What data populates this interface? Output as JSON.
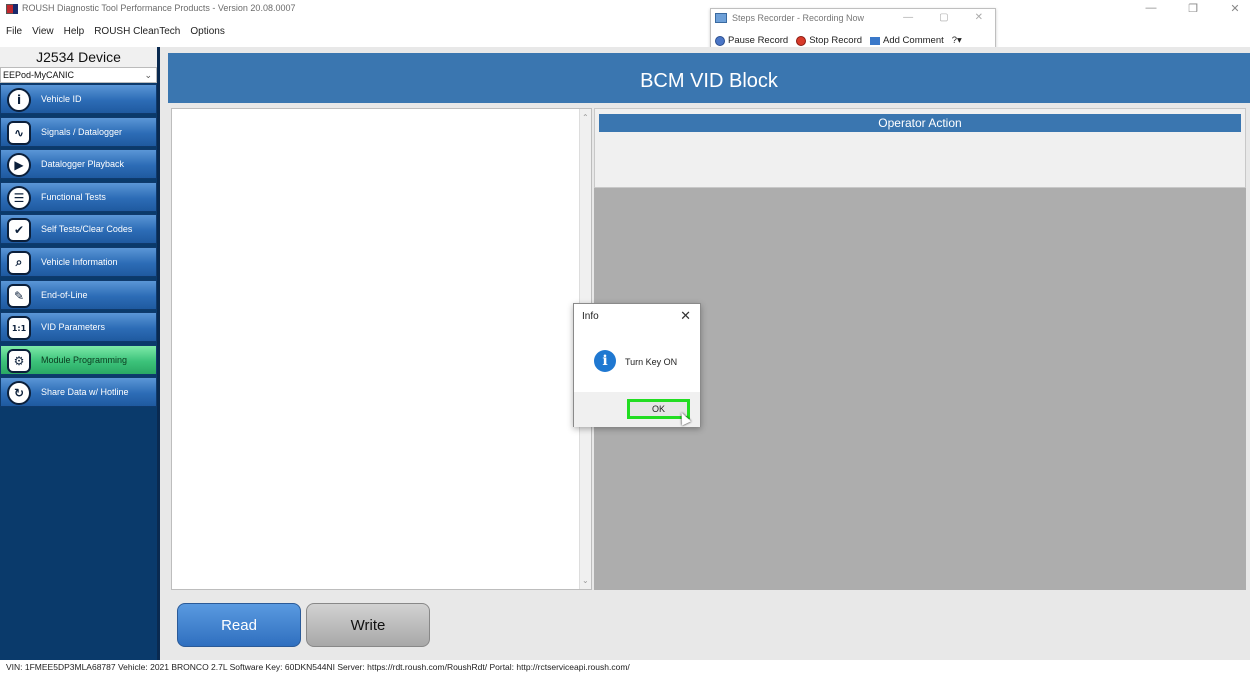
{
  "window": {
    "title": "ROUSH Diagnostic Tool Performance Products - Version 20.08.0007",
    "controls": [
      "—",
      "❐",
      "✕"
    ]
  },
  "menu": [
    "File",
    "View",
    "Help",
    "ROUSH CleanTech",
    "Options"
  ],
  "steps_recorder": {
    "title": "Steps Recorder - Recording Now",
    "controls": [
      "—",
      "▢",
      "✕"
    ],
    "pause_label": "Pause Record",
    "stop_label": "Stop Record",
    "comment_label": "Add Comment",
    "help_label": "?▾"
  },
  "sidebar": {
    "device_title": "J2534 Device",
    "device_selected": "EEPod-MyCANIC",
    "items": [
      {
        "label": "Vehicle ID",
        "icon": "i"
      },
      {
        "label": "Signals / Datalogger",
        "icon": "∿"
      },
      {
        "label": "Datalogger Playback",
        "icon": "▶"
      },
      {
        "label": "Functional Tests",
        "icon": "☰"
      },
      {
        "label": "Self Tests/Clear Codes",
        "icon": "✔"
      },
      {
        "label": "Vehicle Information",
        "icon": "⌕"
      },
      {
        "label": "End-of-Line",
        "icon": "✎"
      },
      {
        "label": "VID Parameters",
        "icon": "1:1"
      },
      {
        "label": "Module Programming",
        "icon": "⚙"
      },
      {
        "label": "Share Data w/ Hotline",
        "icon": "↻"
      }
    ]
  },
  "main": {
    "header": "BCM VID Block",
    "operator_action_title": "Operator Action",
    "read_label": "Read",
    "write_label": "Write"
  },
  "dialog": {
    "title": "Info",
    "message": "Turn Key ON",
    "ok_label": "OK"
  },
  "statusbar": "VIN: 1FMEE5DP3MLA68787  Vehicle: 2021 BRONCO 2.7L Software Key: 60DKN544NI  Server: https://rdt.roush.com/RoushRdt/  Portal: http://rctserviceapi.roush.com/"
}
